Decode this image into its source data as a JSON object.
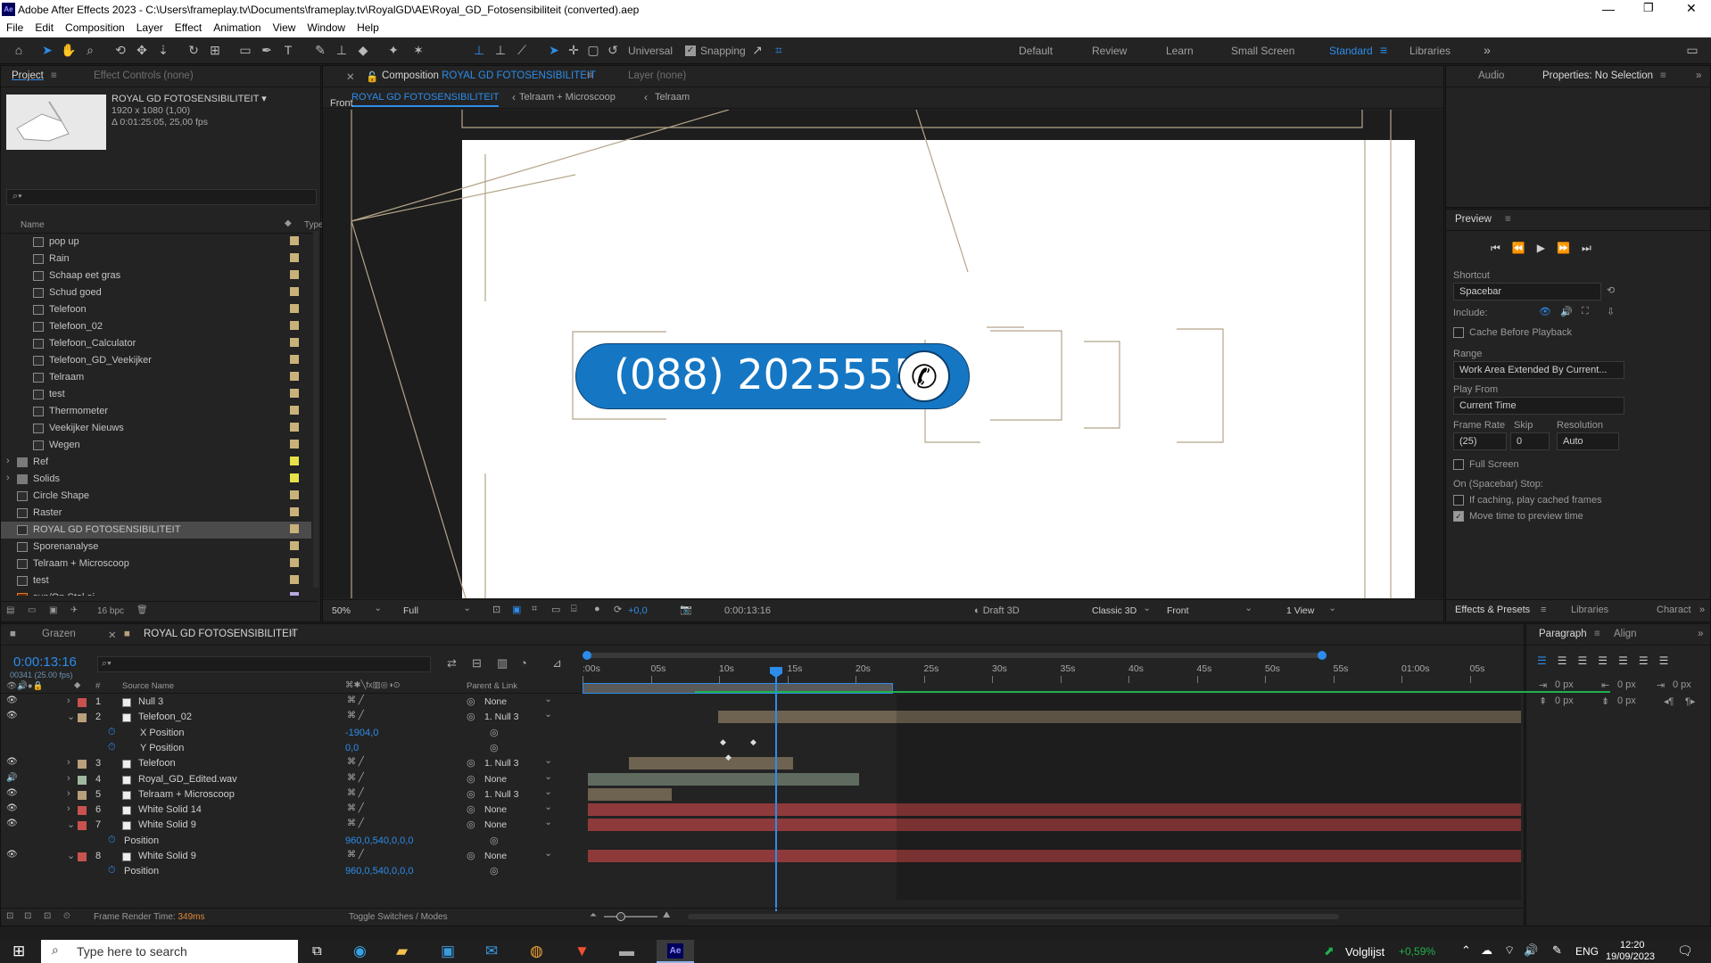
{
  "window": {
    "title": "Adobe After Effects 2023 - C:\\Users\\frameplay.tv\\Documents\\frameplay.tv\\RoyalGD\\AE\\Royal_GD_Fotosensibiliteit (converted).aep",
    "app_icon": "Ae"
  },
  "menu": [
    "File",
    "Edit",
    "Composition",
    "Layer",
    "Effect",
    "Animation",
    "View",
    "Window",
    "Help"
  ],
  "toolbar": {
    "universal": "Universal",
    "snapping": "Snapping",
    "workspaces": [
      "Default",
      "Review",
      "Learn",
      "Small Screen",
      "Standard",
      "Libraries"
    ]
  },
  "project": {
    "tab": "Project",
    "effect_tab": "Effect Controls (none)",
    "comp_name": "ROYAL GD FOTOSENSIBILITEIT",
    "comp_size": "1920 x 1080 (1,00)",
    "comp_duration": "Δ 0:01:25:05, 25,00 fps",
    "col_name": "Name",
    "col_type": "Type",
    "bpc": "16 bpc",
    "items": [
      {
        "name": "pop up",
        "indent": 2,
        "color": "#c9b27a"
      },
      {
        "name": "Rain",
        "indent": 2,
        "color": "#c9b27a"
      },
      {
        "name": "Schaap eet gras",
        "indent": 2,
        "color": "#c9b27a"
      },
      {
        "name": "Schud goed",
        "indent": 2,
        "color": "#c9b27a"
      },
      {
        "name": "Telefoon",
        "indent": 2,
        "color": "#c9b27a"
      },
      {
        "name": "Telefoon_02",
        "indent": 2,
        "color": "#c9b27a"
      },
      {
        "name": "Telefoon_Calculator",
        "indent": 2,
        "color": "#c9b27a"
      },
      {
        "name": "Telefoon_GD_Veekijker",
        "indent": 2,
        "color": "#c9b27a"
      },
      {
        "name": "Telraam",
        "indent": 2,
        "color": "#c9b27a"
      },
      {
        "name": "test",
        "indent": 2,
        "color": "#c9b27a"
      },
      {
        "name": "Thermometer",
        "indent": 2,
        "color": "#c9b27a"
      },
      {
        "name": "Veekijker Nieuws",
        "indent": 2,
        "color": "#c9b27a"
      },
      {
        "name": "Wegen",
        "indent": 2,
        "color": "#c9b27a"
      },
      {
        "name": "Ref",
        "indent": 1,
        "color": "#e8e04a",
        "folder": true
      },
      {
        "name": "Solids",
        "indent": 1,
        "color": "#e8e04a",
        "folder": true
      },
      {
        "name": "Circle Shape",
        "indent": 1,
        "color": "#c9b27a"
      },
      {
        "name": "Raster",
        "indent": 1,
        "color": "#c9b27a"
      },
      {
        "name": "ROYAL GD FOTOSENSIBILITEIT",
        "indent": 1,
        "color": "#c9b27a",
        "selected": true
      },
      {
        "name": "Sporenanalyse",
        "indent": 1,
        "color": "#c9b27a"
      },
      {
        "name": "Telraam + Microscoop",
        "indent": 1,
        "color": "#c9b27a"
      },
      {
        "name": "test",
        "indent": 1,
        "color": "#c9b27a"
      },
      {
        "name": "sun/Op Stal.ai",
        "indent": 1,
        "color": "#b9a8e0",
        "ai": true
      }
    ]
  },
  "composition": {
    "tab_prefix": "Composition",
    "tab_name": "ROYAL GD FOTOSENSIBILITEIT",
    "layer_tab": "Layer (none)",
    "crumbs": [
      "ROYAL GD FOTOSENSIBILITEIT",
      "Telraam + Microscoop",
      "Telraam"
    ],
    "view_label": "Front",
    "phone_number": "(088) 2025555",
    "footer": {
      "zoom": "50%",
      "quality": "Full",
      "exposure": "+0,0",
      "timecode": "0:00:13:16",
      "draft": "Draft 3D",
      "renderer": "Classic 3D",
      "view": "Front",
      "views": "1 View"
    }
  },
  "right": {
    "audio_tab": "Audio",
    "properties_tab": "Properties: No Selection",
    "preview_title": "Preview",
    "shortcut_label": "Shortcut",
    "shortcut_value": "Spacebar",
    "include_label": "Include:",
    "cache_label": "Cache Before Playback",
    "range_label": "Range",
    "range_value": "Work Area Extended By Current...",
    "playfrom_label": "Play From",
    "playfrom_value": "Current Time",
    "framerate_label": "Frame Rate",
    "skip_label": "Skip",
    "resolution_label": "Resolution",
    "framerate_value": "(25)",
    "skip_value": "0",
    "resolution_value": "Auto",
    "fullscreen_label": "Full Screen",
    "stop_label": "On (Spacebar) Stop:",
    "ifcaching_label": "If caching, play cached frames",
    "movetime_label": "Move time to preview time",
    "effects_tab": "Effects & Presets",
    "libraries_tab": "Libraries",
    "character_tab": "Charact",
    "paragraph_tab": "Paragraph",
    "align_tab": "Align",
    "px_values": [
      "0 px",
      "0 px",
      "0 px",
      "0 px",
      "0 px"
    ]
  },
  "timeline": {
    "tabs": [
      "Grazen",
      "ROYAL GD FOTOSENSIBILITEIT"
    ],
    "timecode": "0:00:13:16",
    "frames": "00341 (25.00 fps)",
    "col_source": "Source Name",
    "col_parent": "Parent & Link",
    "ruler": [
      ":00s",
      "05s",
      "10s",
      "15s",
      "20s",
      "25s",
      "30s",
      "35s",
      "40s",
      "45s",
      "50s",
      "55s",
      "01:00s",
      "05s"
    ],
    "render_time_label": "Frame Render Time:",
    "render_time_value": "349ms",
    "toggle": "Toggle Switches / Modes",
    "layers": [
      {
        "num": "1",
        "name": "Null 3",
        "parent": "None",
        "label": "#c9524f",
        "prop": false
      },
      {
        "num": "2",
        "name": "Telefoon_02",
        "parent": "1. Null 3",
        "label": "#b8a07a",
        "prop": false,
        "expanded": true
      },
      {
        "num": "",
        "name": "X Position",
        "parent": "",
        "value": "-1904,0",
        "prop": true
      },
      {
        "num": "",
        "name": "Y Position",
        "parent": "",
        "value": "0,0",
        "prop": true
      },
      {
        "num": "3",
        "name": "Telefoon",
        "parent": "1. Null 3",
        "label": "#b8a07a",
        "prop": false
      },
      {
        "num": "4",
        "name": "Royal_GD_Edited.wav",
        "parent": "None",
        "label": "#9fb89f",
        "prop": false
      },
      {
        "num": "5",
        "name": "Telraam + Microscoop",
        "parent": "1. Null 3",
        "label": "#b8a07a",
        "prop": false
      },
      {
        "num": "6",
        "name": "White Solid 14",
        "parent": "None",
        "label": "#c9524f",
        "prop": false
      },
      {
        "num": "7",
        "name": "White Solid 9",
        "parent": "None",
        "label": "#c9524f",
        "prop": false,
        "expanded": true
      },
      {
        "num": "",
        "name": "Position",
        "parent": "",
        "value": "960,0,540,0,0,0",
        "prop": true
      },
      {
        "num": "8",
        "name": "White Solid 9",
        "parent": "None",
        "label": "#c9524f",
        "prop": false,
        "expanded": true
      },
      {
        "num": "",
        "name": "Position",
        "parent": "",
        "value": "960,0,540,0,0,0",
        "prop": true
      }
    ]
  },
  "taskbar": {
    "search_placeholder": "Type here to search",
    "stock_name": "Volglijst",
    "stock_value": "+0,59%",
    "lang": "ENG",
    "time": "12:20",
    "date": "19/09/2023"
  }
}
